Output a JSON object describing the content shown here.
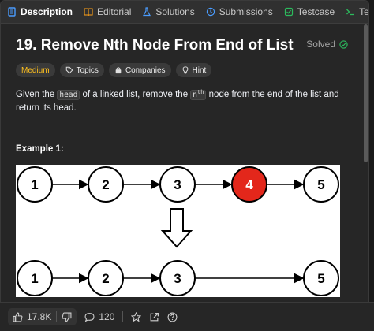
{
  "tabs": [
    {
      "label": "Description",
      "active": true,
      "icon": "description-icon",
      "color": "#4a9cff"
    },
    {
      "label": "Editorial",
      "active": false,
      "icon": "book-icon",
      "color": "#ffa116"
    },
    {
      "label": "Solutions",
      "active": false,
      "icon": "flask-icon",
      "color": "#4a9cff"
    },
    {
      "label": "Submissions",
      "active": false,
      "icon": "history-icon",
      "color": "#4a9cff"
    },
    {
      "label": "Testcase",
      "active": false,
      "icon": "checkbox-icon",
      "color": "#2cbb5d"
    },
    {
      "label": "Test Resul",
      "active": false,
      "icon": "terminal-icon",
      "color": "#2cbb5d"
    }
  ],
  "problem": {
    "title": "19. Remove Nth Node From End of List",
    "status": "Solved"
  },
  "tags": {
    "difficulty": "Medium",
    "topics": "Topics",
    "companies": "Companies",
    "hint": "Hint"
  },
  "description": {
    "t1": "Given the ",
    "code1": "head",
    "t2": " of a linked list, remove the ",
    "code2": "n",
    "sup": "th",
    "t3": " node from the end of the list and return its head."
  },
  "example_label": "Example 1:",
  "diagram": {
    "top_nodes": [
      "1",
      "2",
      "3",
      "4",
      "5"
    ],
    "highlight_index": 3,
    "bottom_nodes": [
      "1",
      "2",
      "3",
      "5"
    ],
    "highlight_color": "#e3271b"
  },
  "footer": {
    "likes": "17.8K",
    "comments": "120"
  },
  "colors": {
    "accent_green": "#2cbb5d",
    "medium": "#ffc01e"
  }
}
